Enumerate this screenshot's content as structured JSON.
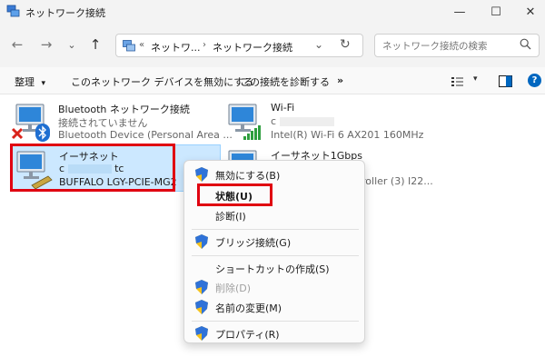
{
  "window": {
    "title": "ネットワーク接続",
    "minimize": "—",
    "maximize": "☐",
    "close": "✕"
  },
  "nav": {
    "back": "←",
    "forward": "→",
    "history": "⌄",
    "up": "↑",
    "breadcrumb_overflow": "«",
    "crumb1": "ネットワ...",
    "crumb2": "ネットワーク接続",
    "crumb_sep": "›",
    "dropdown": "⌄",
    "refresh": "↻"
  },
  "search": {
    "placeholder": "ネットワーク接続の検索",
    "icon": "search-icon"
  },
  "commands": {
    "organize": "整理",
    "organize_caret": "▾",
    "disable_device": "このネットワーク デバイスを無効にする",
    "diagnose": "この接続を診断する",
    "more": "»",
    "view_caret": "▾",
    "help": "?"
  },
  "connections": [
    {
      "name": "Bluetooth ネットワーク接続",
      "status": "接続されていません",
      "device": "Bluetooth Device (Personal Area ..."
    },
    {
      "name": "Wi-Fi",
      "status": "c",
      "device": "Intel(R) Wi-Fi 6 AX201 160MHz"
    },
    {
      "name": "イーサネット",
      "status_left": "c",
      "status_right": "tc",
      "device": "BUFFALO LGY-PCIE-MG2"
    },
    {
      "name": "イーサネット1Gbps",
      "status": "",
      "device": "roller (3) I22..."
    }
  ],
  "context_menu": {
    "items": [
      {
        "label": "無効にする(B)",
        "shield": true,
        "disabled": false
      },
      {
        "label": "状態(U)",
        "shield": false,
        "disabled": false
      },
      {
        "label": "診断(I)",
        "shield": false,
        "disabled": false
      },
      {
        "label": "ブリッジ接続(G)",
        "shield": true,
        "disabled": false
      },
      {
        "label": "ショートカットの作成(S)",
        "shield": false,
        "disabled": false
      },
      {
        "label": "削除(D)",
        "shield": true,
        "disabled": true
      },
      {
        "label": "名前の変更(M)",
        "shield": true,
        "disabled": false
      },
      {
        "label": "プロパティ(R)",
        "shield": true,
        "disabled": false
      }
    ]
  },
  "colors": {
    "highlight": "#e00010",
    "selection": "#cce8ff",
    "accent": "#0067c0"
  }
}
